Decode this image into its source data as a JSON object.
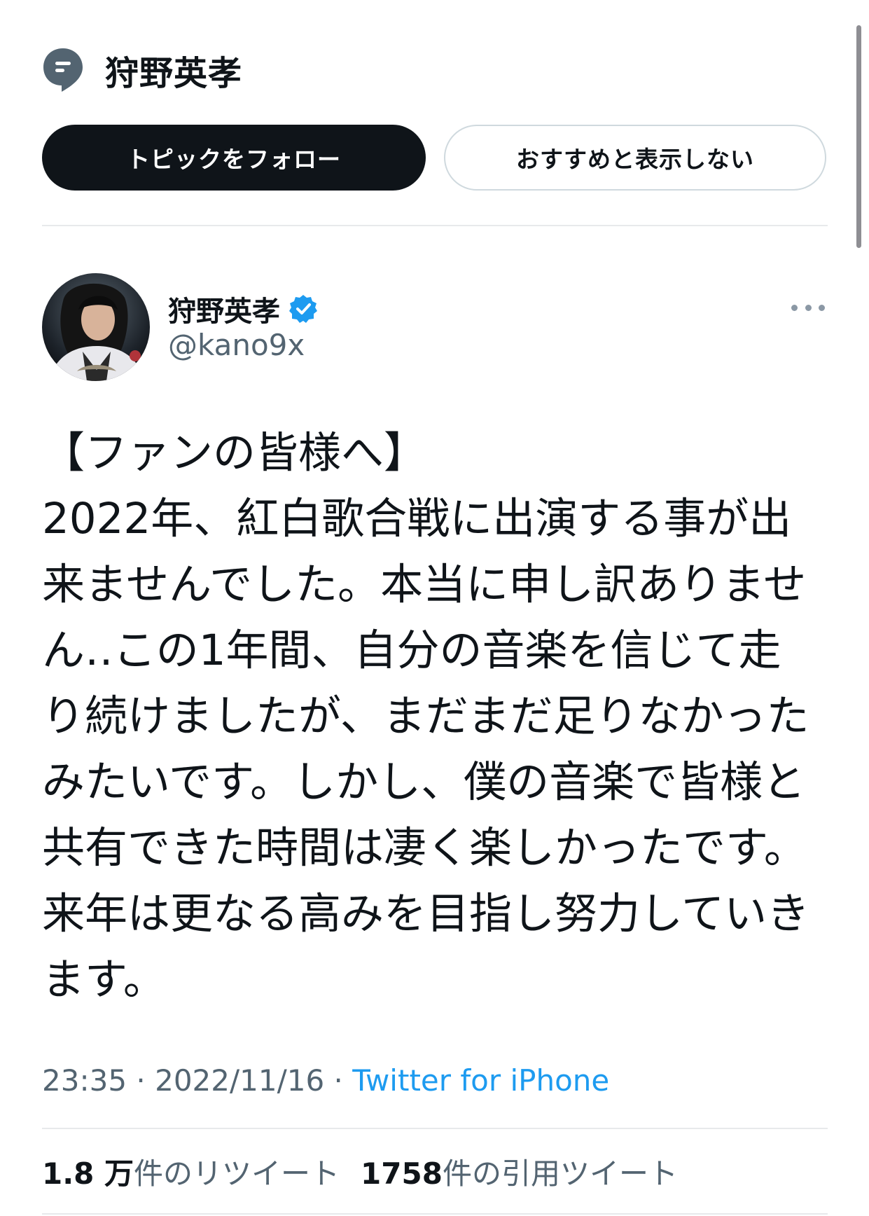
{
  "topic": {
    "title": "狩野英孝",
    "icon": "topic-bubble-icon"
  },
  "buttons": {
    "follow_label": "トピックをフォロー",
    "hide_label": "おすすめと表示しない"
  },
  "author": {
    "name": "狩野英孝",
    "handle": "@kano9x",
    "verified": true,
    "verified_color": "#1d9bf0"
  },
  "tweet": {
    "lines": [
      "【ファンの皆様へ】",
      "2022年、紅白歌合戦に出演する事が出",
      "来ませんでした。本当に申し訳ありませ",
      "ん‥この1年間、自分の音楽を信じて走",
      "り続けましたが、まだまだ足りなかった",
      "みたいです。しかし、僕の音楽で皆様と",
      "共有できた時間は凄く楽しかったです。",
      "来年は更なる高みを目指し努力していき",
      "ます。"
    ]
  },
  "meta": {
    "time": "23:35",
    "separator": " · ",
    "date": "2022/11/16",
    "source": "Twitter for iPhone"
  },
  "stats": {
    "retweets_count": "1.8 万",
    "retweets_label": "件のリツイート",
    "quotes_count": "1758",
    "quotes_label": "件の引用ツイート"
  },
  "colors": {
    "text": "#0f1419",
    "secondary": "#536471",
    "link": "#1d9bf0",
    "divider": "#e7e9eb"
  }
}
